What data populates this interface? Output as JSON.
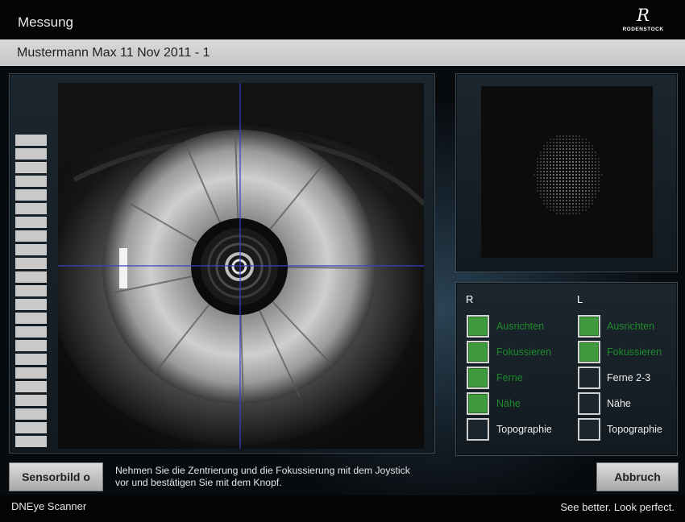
{
  "window": {
    "title": "Messung"
  },
  "brand": {
    "logo_text": "RODENSTOCK",
    "logo_mark": "R",
    "tagline": "See better. Look perfect."
  },
  "patient": {
    "label": "Mustermann Max 11 Nov 2011 - 1"
  },
  "level_meter": {
    "segment_count": 23
  },
  "status": {
    "right": {
      "label": "R",
      "steps": [
        {
          "label": "Ausrichten",
          "done": true
        },
        {
          "label": "Fokussieren",
          "done": true
        },
        {
          "label": "Ferne",
          "done": true
        },
        {
          "label": "Nähe",
          "done": true
        },
        {
          "label": "Topographie",
          "done": false
        }
      ]
    },
    "left": {
      "label": "L",
      "steps": [
        {
          "label": "Ausrichten",
          "done": true
        },
        {
          "label": "Fokussieren",
          "done": true
        },
        {
          "label": "Ferne 2-3",
          "done": false
        },
        {
          "label": "Nähe",
          "done": false
        },
        {
          "label": "Topographie",
          "done": false
        }
      ]
    }
  },
  "buttons": {
    "sensor_label": "Sensorbild o",
    "abort_label": "Abbruch"
  },
  "instruction": "Nehmen Sie die Zentrierung und die Fokussierung mit dem Joystick\nvor und bestätigen Sie mit dem Knopf.",
  "footer": {
    "app_name": "DNEye Scanner"
  },
  "colors": {
    "done": "#3f9a3d",
    "done_text": "#1f8a2a",
    "crosshair": "#3d3dc8"
  },
  "icons": {
    "eye_image": "iris-camera-feed",
    "topo_image": "topography-dot-pattern"
  }
}
